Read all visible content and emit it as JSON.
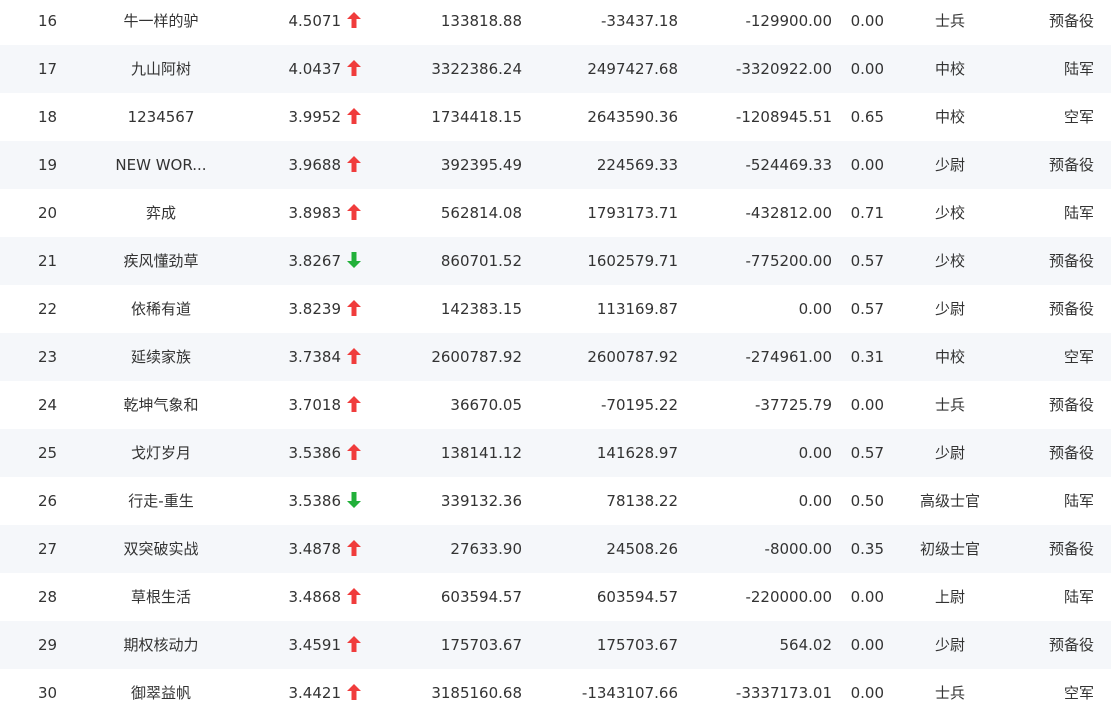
{
  "colors": {
    "up": "#f03c3c",
    "down": "#22b03a",
    "text": "#333333",
    "stripe": "#f5f7fa"
  },
  "rows": [
    {
      "rank": "16",
      "name": "牛一样的驴",
      "score": "4.5071",
      "trend": "up",
      "v1": "133818.88",
      "v2": "-33437.18",
      "v3": "-129900.00",
      "ratio": "0.00",
      "title": "士兵",
      "branch": "预备役"
    },
    {
      "rank": "17",
      "name": "九山阿树",
      "score": "4.0437",
      "trend": "up",
      "v1": "3322386.24",
      "v2": "2497427.68",
      "v3": "-3320922.00",
      "ratio": "0.00",
      "title": "中校",
      "branch": "陆军"
    },
    {
      "rank": "18",
      "name": "1234567",
      "score": "3.9952",
      "trend": "up",
      "v1": "1734418.15",
      "v2": "2643590.36",
      "v3": "-1208945.51",
      "ratio": "0.65",
      "title": "中校",
      "branch": "空军"
    },
    {
      "rank": "19",
      "name": "NEW WOR...",
      "score": "3.9688",
      "trend": "up",
      "v1": "392395.49",
      "v2": "224569.33",
      "v3": "-524469.33",
      "ratio": "0.00",
      "title": "少尉",
      "branch": "预备役"
    },
    {
      "rank": "20",
      "name": "弈成",
      "score": "3.8983",
      "trend": "up",
      "v1": "562814.08",
      "v2": "1793173.71",
      "v3": "-432812.00",
      "ratio": "0.71",
      "title": "少校",
      "branch": "陆军"
    },
    {
      "rank": "21",
      "name": "疾风懂劲草",
      "score": "3.8267",
      "trend": "down",
      "v1": "860701.52",
      "v2": "1602579.71",
      "v3": "-775200.00",
      "ratio": "0.57",
      "title": "少校",
      "branch": "预备役"
    },
    {
      "rank": "22",
      "name": "依稀有道",
      "score": "3.8239",
      "trend": "up",
      "v1": "142383.15",
      "v2": "113169.87",
      "v3": "0.00",
      "ratio": "0.57",
      "title": "少尉",
      "branch": "预备役"
    },
    {
      "rank": "23",
      "name": "延续家族",
      "score": "3.7384",
      "trend": "up",
      "v1": "2600787.92",
      "v2": "2600787.92",
      "v3": "-274961.00",
      "ratio": "0.31",
      "title": "中校",
      "branch": "空军"
    },
    {
      "rank": "24",
      "name": "乾坤气象和",
      "score": "3.7018",
      "trend": "up",
      "v1": "36670.05",
      "v2": "-70195.22",
      "v3": "-37725.79",
      "ratio": "0.00",
      "title": "士兵",
      "branch": "预备役"
    },
    {
      "rank": "25",
      "name": "戈灯岁月",
      "score": "3.5386",
      "trend": "up",
      "v1": "138141.12",
      "v2": "141628.97",
      "v3": "0.00",
      "ratio": "0.57",
      "title": "少尉",
      "branch": "预备役"
    },
    {
      "rank": "26",
      "name": "行走-重生",
      "score": "3.5386",
      "trend": "down",
      "v1": "339132.36",
      "v2": "78138.22",
      "v3": "0.00",
      "ratio": "0.50",
      "title": "高级士官",
      "branch": "陆军"
    },
    {
      "rank": "27",
      "name": "双突破实战",
      "score": "3.4878",
      "trend": "up",
      "v1": "27633.90",
      "v2": "24508.26",
      "v3": "-8000.00",
      "ratio": "0.35",
      "title": "初级士官",
      "branch": "预备役"
    },
    {
      "rank": "28",
      "name": "草根生活",
      "score": "3.4868",
      "trend": "up",
      "v1": "603594.57",
      "v2": "603594.57",
      "v3": "-220000.00",
      "ratio": "0.00",
      "title": "上尉",
      "branch": "陆军"
    },
    {
      "rank": "29",
      "name": "期权核动力",
      "score": "3.4591",
      "trend": "up",
      "v1": "175703.67",
      "v2": "175703.67",
      "v3": "564.02",
      "ratio": "0.00",
      "title": "少尉",
      "branch": "预备役"
    },
    {
      "rank": "30",
      "name": "御翠益帆",
      "score": "3.4421",
      "trend": "up",
      "v1": "3185160.68",
      "v2": "-1343107.66",
      "v3": "-3337173.01",
      "ratio": "0.00",
      "title": "士兵",
      "branch": "空军"
    }
  ]
}
